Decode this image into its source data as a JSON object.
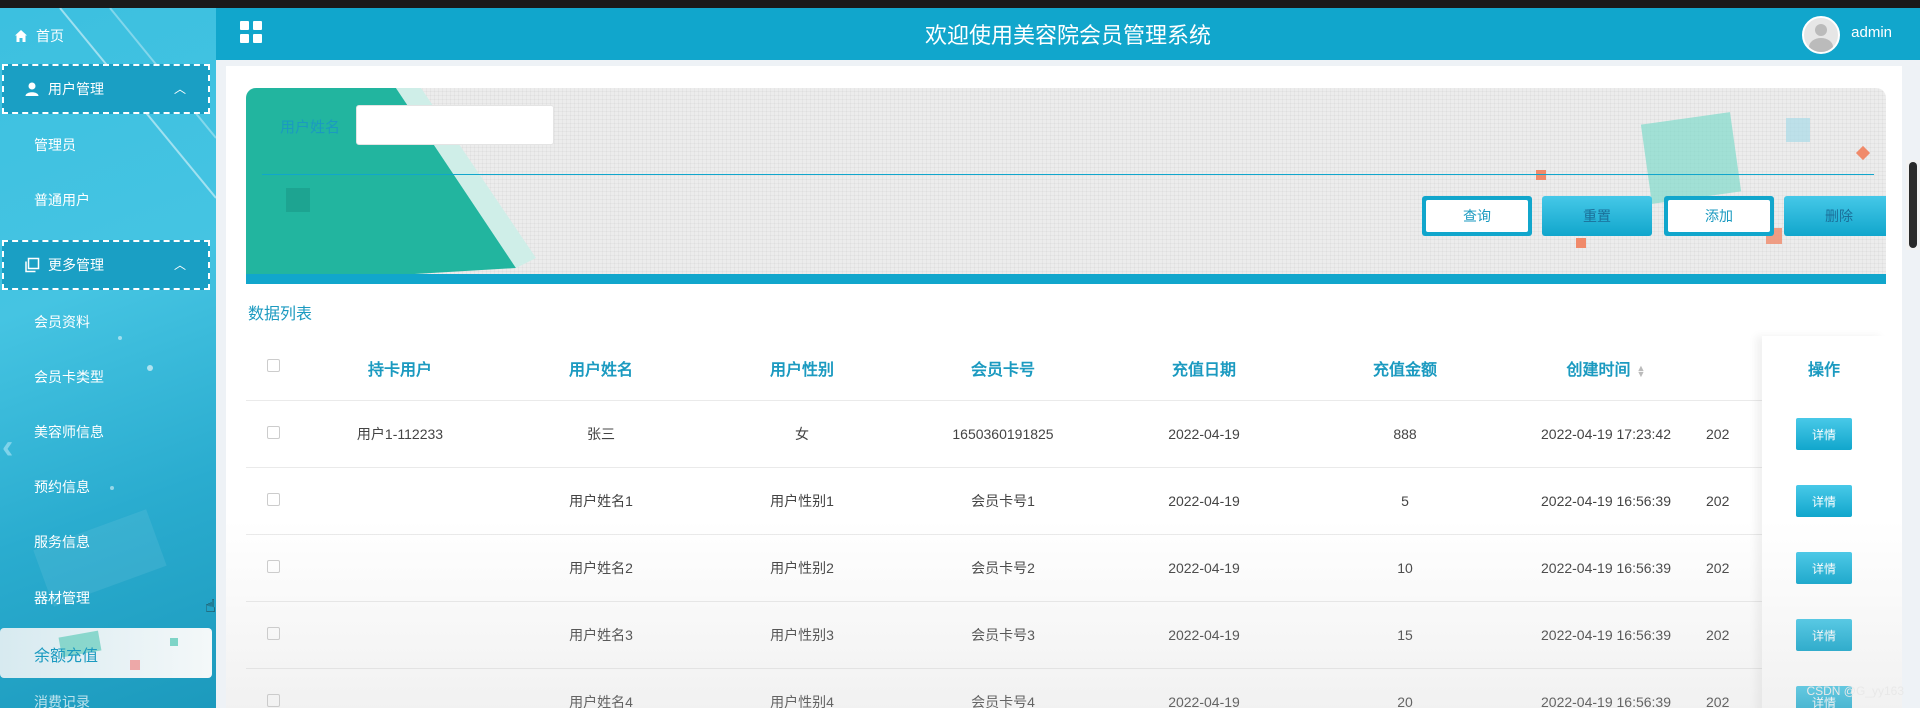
{
  "sidebar": {
    "home": "首页",
    "groups": [
      {
        "label": "用户管理",
        "items": [
          "管理员",
          "普通用户"
        ]
      },
      {
        "label": "更多管理",
        "items": [
          "会员资料",
          "会员卡类型",
          "美容师信息",
          "预约信息",
          "服务信息",
          "器材管理"
        ]
      }
    ],
    "active_item": "余额充值",
    "partial_item": "消费记录"
  },
  "header": {
    "title": "欢迎使用美容院会员管理系统",
    "username": "admin"
  },
  "search": {
    "label": "用户姓名",
    "value": "",
    "buttons": {
      "query": "查询",
      "reset": "重置",
      "add": "添加",
      "delete": "删除"
    }
  },
  "list_title": "数据列表",
  "table": {
    "columns": [
      "持卡用户",
      "用户姓名",
      "用户性别",
      "会员卡号",
      "充值日期",
      "充值金额",
      "创建时间",
      "操作"
    ],
    "rows": [
      [
        "用户1-112233",
        "张三",
        "女",
        "1650360191825",
        "2022-04-19",
        "888",
        "2022-04-19 17:23:42",
        "202"
      ],
      [
        "",
        "用户姓名1",
        "用户性别1",
        "会员卡号1",
        "2022-04-19",
        "5",
        "2022-04-19 16:56:39",
        "202"
      ],
      [
        "",
        "用户姓名2",
        "用户性别2",
        "会员卡号2",
        "2022-04-19",
        "10",
        "2022-04-19 16:56:39",
        "202"
      ],
      [
        "",
        "用户姓名3",
        "用户性别3",
        "会员卡号3",
        "2022-04-19",
        "15",
        "2022-04-19 16:56:39",
        "202"
      ],
      [
        "",
        "用户姓名4",
        "用户性别4",
        "会员卡号4",
        "2022-04-19",
        "20",
        "2022-04-19 16:56:39",
        "202"
      ]
    ],
    "detail_label": "详情"
  },
  "watermark": "CSDN @G_yy163",
  "colors": {
    "accent": "#11a6cc",
    "sidebar": "#3cc0e0"
  }
}
